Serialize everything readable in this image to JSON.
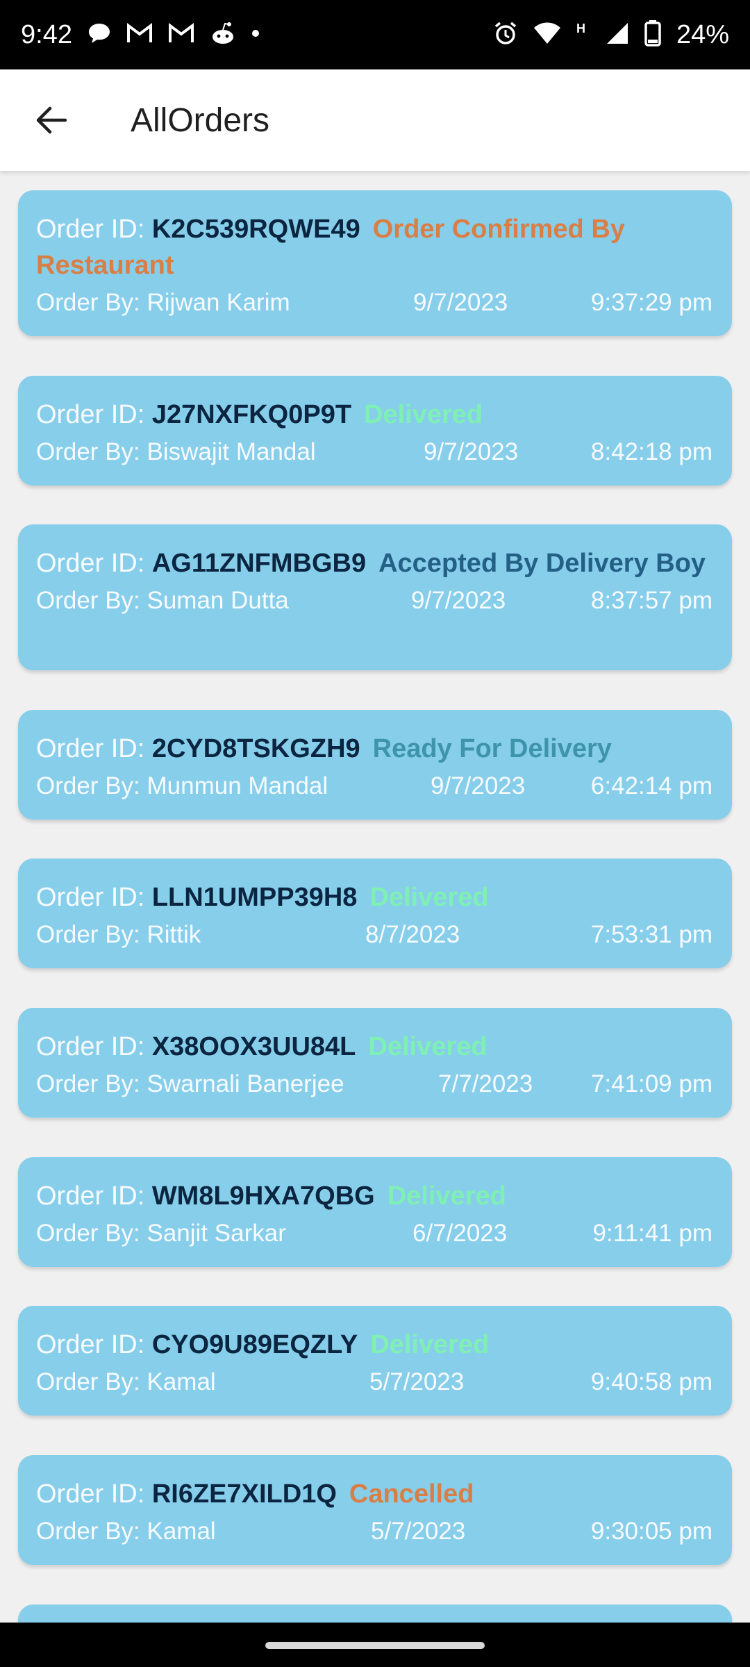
{
  "status_bar": {
    "time": "9:42",
    "battery": "24%",
    "left_icons": [
      "chat-bubble-icon",
      "gmail-icon",
      "gmail-icon",
      "reddit-icon",
      "dot-icon"
    ],
    "right_icons": [
      "alarm-icon",
      "wifi-icon",
      "h-network-icon",
      "signal-icon",
      "battery-icon"
    ]
  },
  "app_bar": {
    "title": "AllOrders"
  },
  "labels": {
    "order_id": "Order ID: ",
    "order_by": "Order By: "
  },
  "colors": {
    "card_bg": "#87ceeb",
    "confirmed": "#d97e45",
    "delivered": "#7ff0b4",
    "accepted": "#245f86",
    "ready": "#3e94a8",
    "cancelled": "#d97e45"
  },
  "orders": [
    {
      "id": "K2C539RQWE49",
      "status": "Order Confirmed By Restaurant",
      "status_key": "confirmed",
      "by": "Rijwan Karim",
      "date": "9/7/2023",
      "time": "9:37:29 pm"
    },
    {
      "id": "J27NXFKQ0P9T",
      "status": "Delivered",
      "status_key": "delivered",
      "by": "Biswajit Mandal",
      "date": "9/7/2023",
      "time": "8:42:18 pm"
    },
    {
      "id": "AG11ZNFMBGB9",
      "status": "Accepted By Delivery Boy",
      "status_key": "accepted",
      "by": "Suman Dutta",
      "date": "9/7/2023",
      "time": "8:37:57 pm"
    },
    {
      "id": "2CYD8TSKGZH9",
      "status": "Ready For Delivery",
      "status_key": "ready",
      "by": "Munmun Mandal",
      "date": "9/7/2023",
      "time": "6:42:14 pm"
    },
    {
      "id": "LLN1UMPP39H8",
      "status": "Delivered",
      "status_key": "delivered",
      "by": "Rittik",
      "date": "8/7/2023",
      "time": "7:53:31 pm"
    },
    {
      "id": "X38OOX3UU84L",
      "status": "Delivered",
      "status_key": "delivered",
      "by": "Swarnali Banerjee",
      "date": "7/7/2023",
      "time": "7:41:09 pm"
    },
    {
      "id": "WM8L9HXA7QBG",
      "status": "Delivered",
      "status_key": "delivered",
      "by": "Sanjit Sarkar",
      "date": "6/7/2023",
      "time": "9:11:41 pm"
    },
    {
      "id": "CYO9U89EQZLY",
      "status": "Delivered",
      "status_key": "delivered",
      "by": "Kamal",
      "date": "5/7/2023",
      "time": "9:40:58 pm"
    },
    {
      "id": "RI6ZE7XILD1Q",
      "status": "Cancelled",
      "status_key": "cancelled",
      "by": "Kamal",
      "date": "5/7/2023",
      "time": "9:30:05 pm"
    }
  ]
}
